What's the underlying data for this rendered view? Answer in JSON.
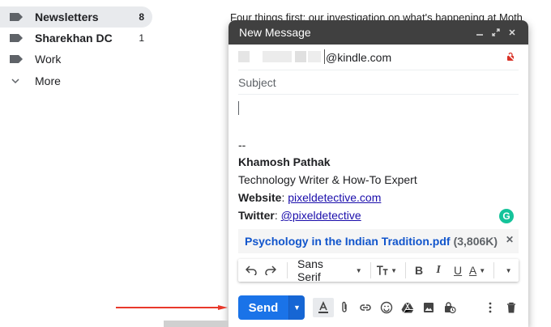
{
  "sidebar": {
    "items": [
      {
        "label": "Newsletters",
        "count": "8",
        "bold": true,
        "active": true
      },
      {
        "label": "Sharekhan DC",
        "count": "1",
        "bold": true,
        "active": false
      },
      {
        "label": "Work",
        "count": "",
        "bold": false,
        "active": false
      },
      {
        "label": "More",
        "count": "",
        "bold": false,
        "active": false
      }
    ]
  },
  "background_email": {
    "preview": "Four things first: our investigation on what's happening at Moth"
  },
  "compose": {
    "title": "New Message",
    "to_value": "@kindle.com",
    "subject_placeholder": "Subject",
    "signature": {
      "dashes": "--",
      "name": "Khamosh Pathak",
      "role": "Technology Writer & How-To Expert",
      "website_label": "Website",
      "website_link": "pixeldetective.com",
      "twitter_label": "Twitter",
      "twitter_link": "@pixeldetective"
    },
    "attachment": {
      "name": "Psychology in the Indian Tradition.pdf",
      "size": "(3,806K)"
    },
    "format_bar": {
      "font": "Sans Serif"
    },
    "send_label": "Send"
  },
  "colors": {
    "send_blue": "#1a73e8",
    "header_dark": "#404040",
    "arrow_red": "#e8392b",
    "link_blue": "#1a0dab"
  }
}
